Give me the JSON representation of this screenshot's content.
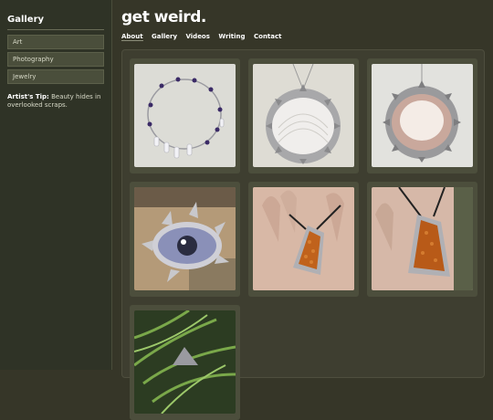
{
  "sidebar": {
    "title": "Gallery",
    "items": [
      {
        "label": "Art"
      },
      {
        "label": "Photography"
      },
      {
        "label": "Jewelry"
      }
    ],
    "tip_label": "Artist's Tip:",
    "tip_text": "Beauty hides in overlooked scraps."
  },
  "header": {
    "brand": "get weird.",
    "nav": [
      {
        "label": "About"
      },
      {
        "label": "Gallery"
      },
      {
        "label": "Videos"
      },
      {
        "label": "Writing"
      },
      {
        "label": "Contact"
      }
    ]
  },
  "gallery": {
    "items": [
      {
        "subject": "beaded-bracelet"
      },
      {
        "subject": "white-shell-pendant"
      },
      {
        "subject": "pink-shell-pendant"
      },
      {
        "subject": "eye-pendant"
      },
      {
        "subject": "amber-pendant-hand"
      },
      {
        "subject": "amber-pendant-hand-closeup"
      },
      {
        "subject": "pendant-in-plants"
      }
    ]
  }
}
